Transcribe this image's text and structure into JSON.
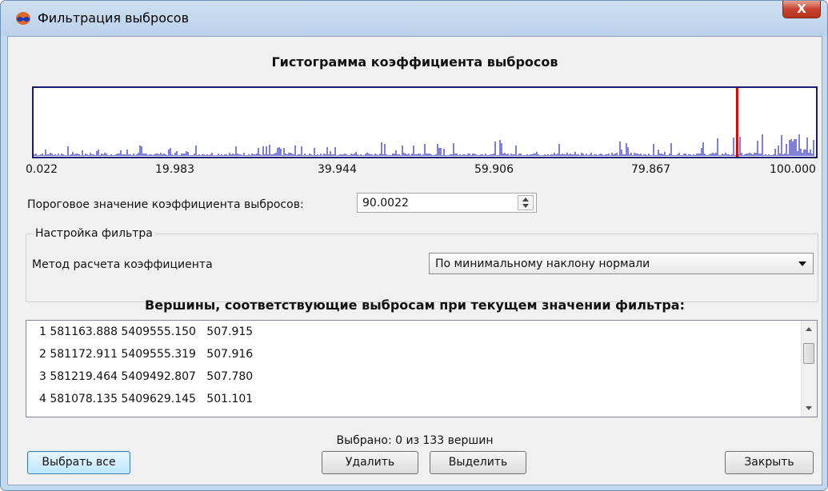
{
  "window": {
    "title": "Фильтрация выбросов",
    "close_glyph": "X"
  },
  "histogram": {
    "title": "Гистограмма коэффициента выбросов",
    "ticks": [
      "0.022",
      "19.983",
      "39.944",
      "59.906",
      "79.867",
      "100.000"
    ],
    "threshold_marker_color": "#e00000",
    "bar_color": "#0000b0",
    "threshold": 90.0022,
    "x_min": 0.022,
    "x_max": 100.0
  },
  "threshold": {
    "label": "Пороговое значение коэффициента выбросов:",
    "value": "90.0022"
  },
  "filter_settings": {
    "group_title": "Настройка фильтра",
    "method_label": "Метод расчета коэффициента",
    "method_value": "По минимальному наклону нормали"
  },
  "vertices": {
    "title": "Вершины, соответствующие выбросам при текущем значении фильтра:",
    "rows": [
      "1 581163.888 5409555.150   507.915",
      "2 581172.911 5409555.319   507.916",
      "3 581219.464 5409492.807   507.780",
      "4 581078.135 5409629.145   501.101"
    ]
  },
  "status": "Выбрано: 0 из 133 вершин",
  "buttons": {
    "select_all": "Выбрать все",
    "delete": "Удалить",
    "highlight": "Выделить",
    "close": "Закрыть"
  }
}
